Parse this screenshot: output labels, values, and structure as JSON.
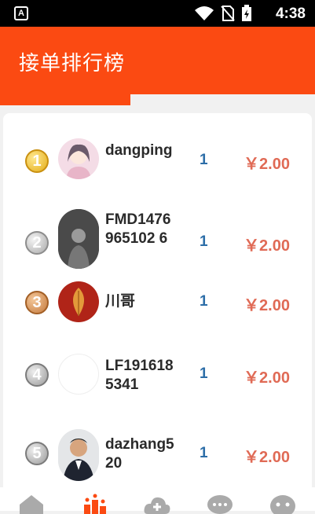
{
  "status_bar": {
    "time": "4:38",
    "app_badge": "A"
  },
  "header": {
    "title": "接单排行榜"
  },
  "ranking": [
    {
      "rank": "1",
      "medal": "gold",
      "name": "dangping",
      "count": "1",
      "amount": "￥2.00",
      "avatar": "avatar-girl-illustration"
    },
    {
      "rank": "2",
      "medal": "silver",
      "name": "FMD1476965102 6",
      "count": "1",
      "amount": "￥2.00",
      "avatar": "avatar-bw-photo"
    },
    {
      "rank": "3",
      "medal": "bronze",
      "name": "川哥",
      "count": "1",
      "amount": "￥2.00",
      "avatar": "avatar-leaf"
    },
    {
      "rank": "4",
      "medal": "gray",
      "name": "LF1916185341",
      "count": "1",
      "amount": "￥2.00",
      "avatar": "avatar-blank"
    },
    {
      "rank": "5",
      "medal": "gray",
      "name": "dazhang520",
      "count": "1",
      "amount": "￥2.00",
      "avatar": "avatar-man-photo"
    }
  ],
  "bottom_nav": [
    {
      "icon": "home-icon",
      "color": "#aaaaaa"
    },
    {
      "icon": "ranking-icon",
      "color": "#fb4a12"
    },
    {
      "icon": "cloud-add-icon",
      "color": "#aaaaaa"
    },
    {
      "icon": "chat-icon",
      "color": "#aaaaaa"
    },
    {
      "icon": "profile-icon",
      "color": "#aaaaaa"
    }
  ],
  "colors": {
    "accent": "#fb4a12",
    "amount": "#e06a55",
    "count": "#2d6ea8"
  }
}
